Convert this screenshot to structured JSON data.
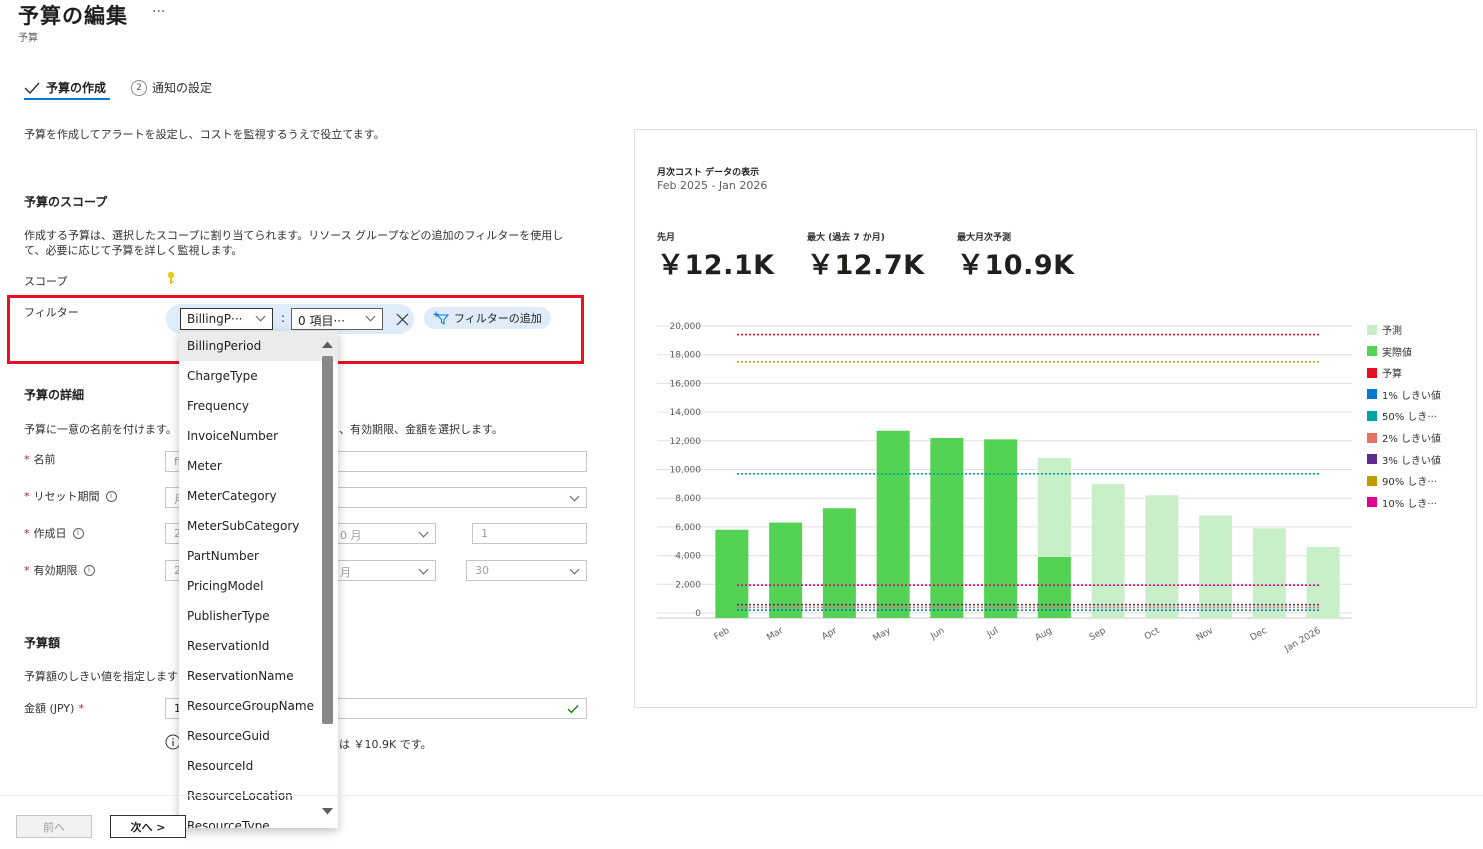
{
  "header": {
    "title": "予算の編集",
    "more": "···",
    "subtitle": "予算"
  },
  "steps": [
    {
      "label": "予算の作成",
      "active": true
    },
    {
      "label": "通知の設定",
      "number": "2",
      "active": false
    }
  ],
  "intro": "予算を作成してアラートを設定し、コストを監視するうえで役立てます。",
  "scope_section": {
    "heading": "予算のスコープ",
    "description": "作成する予算は、選択したスコープに割り当てられます。リソース グループなどの追加のフィルターを使用して、必要に応じて予算を詳しく監視します。",
    "scope_label": "スコープ",
    "filter_label": "フィルター"
  },
  "filter": {
    "property_value": "BillingP···",
    "separator": ":",
    "items_value": "0 項目···",
    "add_filter_label": "フィルターの追加",
    "options": [
      "BillingPeriod",
      "ChargeType",
      "Frequency",
      "InvoiceNumber",
      "Meter",
      "MeterCategory",
      "MeterSubCategory",
      "PartNumber",
      "PricingModel",
      "PublisherType",
      "ReservationId",
      "ReservationName",
      "ResourceGroupName",
      "ResourceGuid",
      "ResourceId",
      "ResourceLocation",
      "ResourceType"
    ],
    "selected_option": "BillingPeriod"
  },
  "details_section": {
    "heading": "予算の詳細",
    "description_start": "予算に一意の名前を付けます。",
    "description_end": "、有効期限、金額を選択します。",
    "name_label": "名前",
    "name_value": "fi",
    "reset_label": "リセット期間",
    "reset_value": "月",
    "created_label": "作成日",
    "created_year": "2",
    "created_month": "0 月",
    "created_day": "1",
    "expiry_label": "有効期限",
    "expiry_year": "2",
    "expiry_month": "月",
    "expiry_day": "30"
  },
  "amount_section": {
    "heading": "予算額",
    "description": "予算額のしきい値を指定します",
    "amount_label": "金額 (JPY)",
    "amount_value": "1",
    "info_text": "は ￥10.9K です。"
  },
  "footer": {
    "prev_label": "前へ",
    "next_label": "次へ >"
  },
  "chart_panel": {
    "title": "月次コスト データの表示",
    "date_range": "Feb 2025 - Jan 2026",
    "kpis": [
      {
        "label": "先月",
        "value": "￥12.1K"
      },
      {
        "label": "最大 (過去 7 か月)",
        "value": "￥12.7K"
      },
      {
        "label": "最大月次予測",
        "value": "￥10.9K"
      }
    ]
  },
  "chart_data": {
    "type": "bar",
    "categories": [
      "Feb",
      "Mar",
      "Apr",
      "May",
      "Jun",
      "Jul",
      "Aug",
      "Sep",
      "Oct",
      "Nov",
      "Dec",
      "Jan 2026"
    ],
    "series": [
      {
        "name": "予測",
        "color": "#c8efc8",
        "values": [
          null,
          null,
          null,
          null,
          null,
          null,
          10800,
          9000,
          8200,
          6800,
          5900,
          4600
        ]
      },
      {
        "name": "実際値",
        "color": "#54d254",
        "values": [
          5800,
          6300,
          7300,
          12700,
          12200,
          12100,
          3900,
          null,
          null,
          null,
          null,
          null
        ]
      }
    ],
    "lines": [
      {
        "name": "予算",
        "color": "#e81123",
        "value": 19400
      },
      {
        "name": "1% しきい値",
        "color": "#0078d4",
        "value": 200
      },
      {
        "name": "50% しき···",
        "color": "#00a3a3",
        "value": 9700
      },
      {
        "name": "2% しきい値",
        "color": "#e3735e",
        "value": 390
      },
      {
        "name": "3% しきい値",
        "color": "#5c2d91",
        "value": 580
      },
      {
        "name": "90% しき···",
        "color": "#c19c00",
        "value": 17500
      },
      {
        "name": "10% しき···",
        "color": "#e3008c",
        "value": 1940
      }
    ],
    "ylim": [
      0,
      20000
    ],
    "yticks": [
      "0",
      "2,000",
      "4,000",
      "6,000",
      "8,000",
      "10,000",
      "12,000",
      "14,000",
      "16,000",
      "18,000",
      "20,000"
    ],
    "grid": true,
    "legend": "right"
  }
}
